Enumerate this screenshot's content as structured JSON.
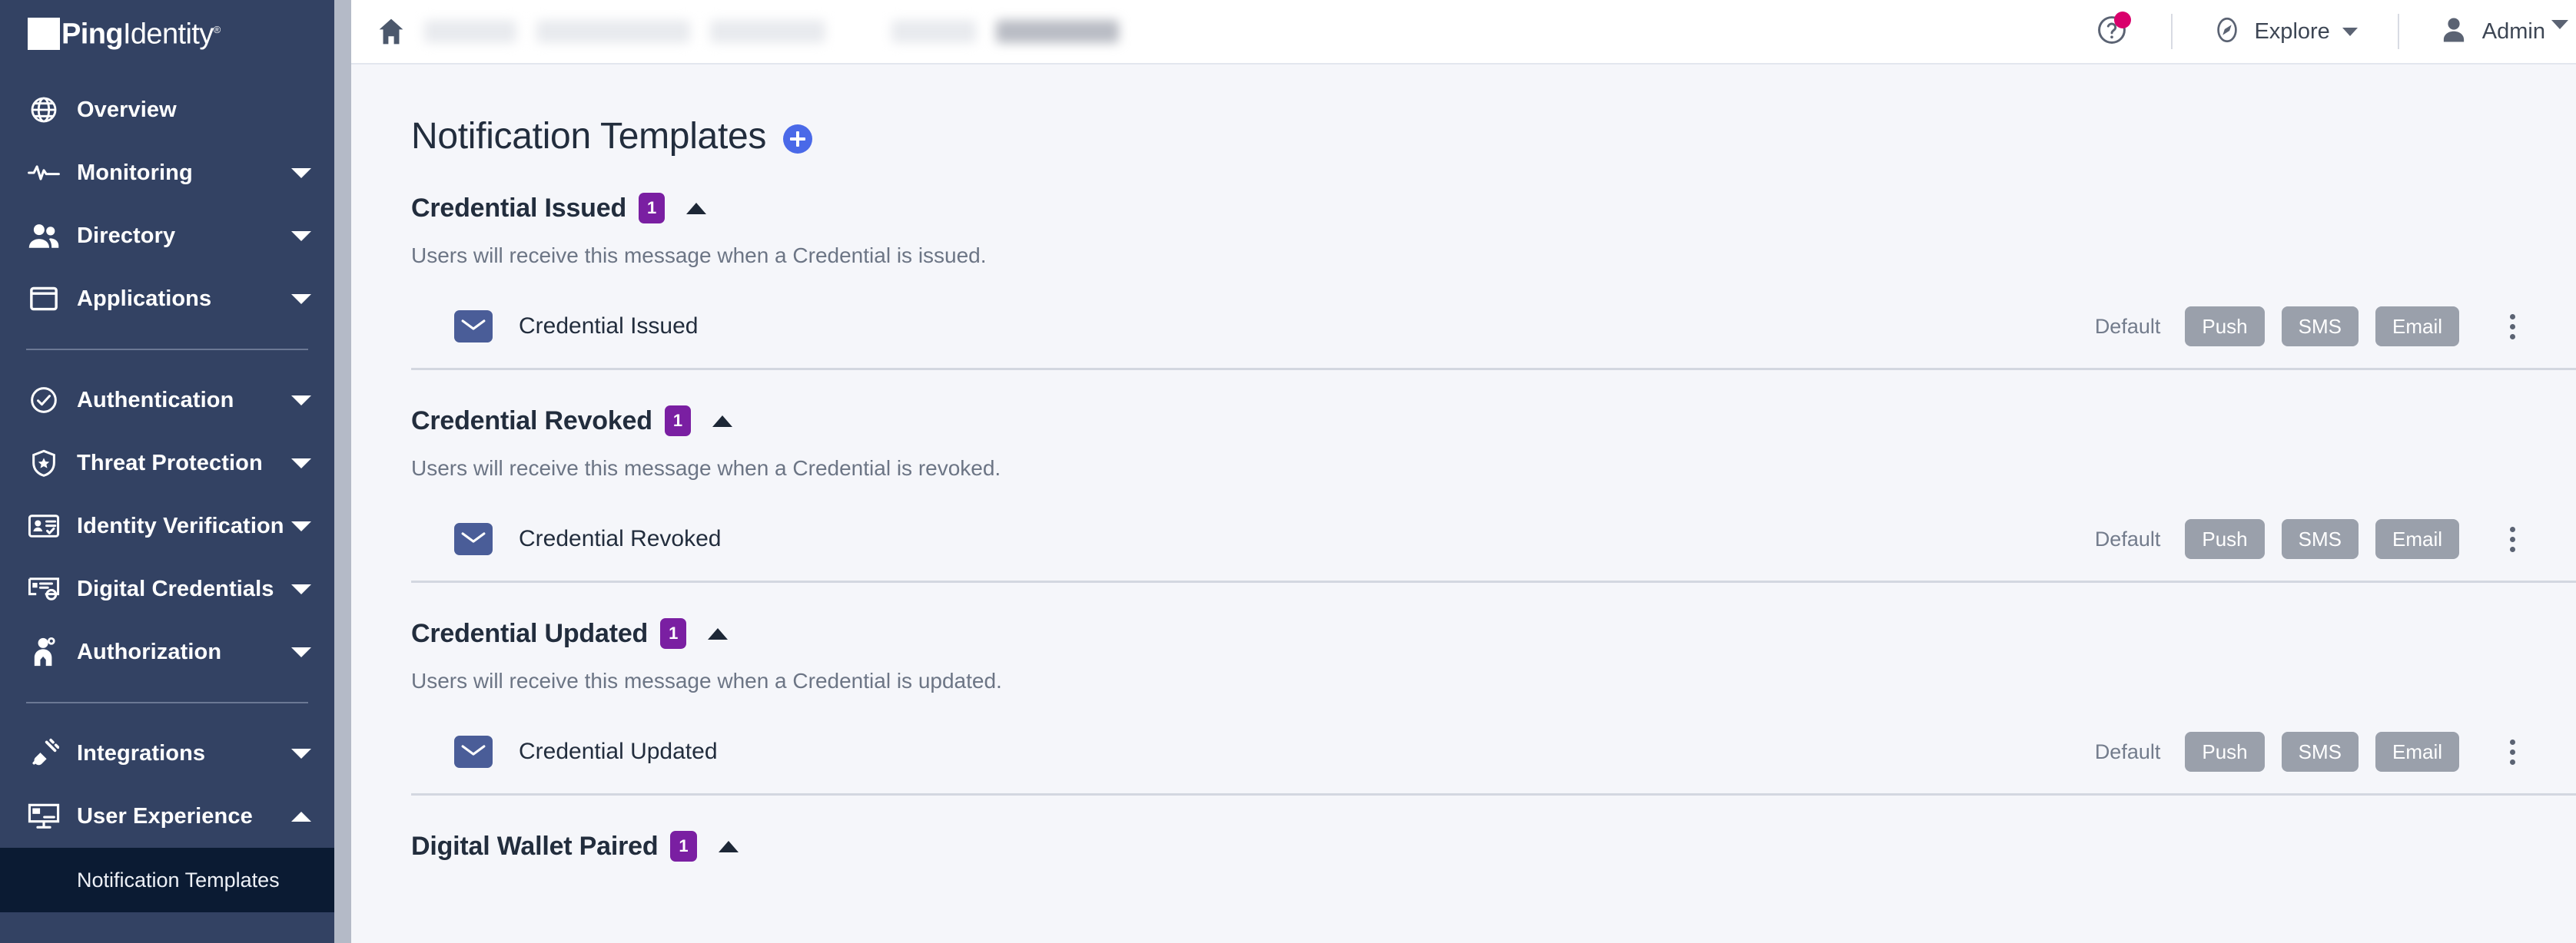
{
  "brand": {
    "name_bold": "Ping",
    "name_light": "Identity",
    "registered": "®"
  },
  "sidebar": {
    "items": [
      {
        "label": "Overview",
        "icon": "globe-icon",
        "expandable": false,
        "expanded": false
      },
      {
        "label": "Monitoring",
        "icon": "pulse-icon",
        "expandable": true,
        "expanded": false
      },
      {
        "label": "Directory",
        "icon": "users-icon",
        "expandable": true,
        "expanded": false
      },
      {
        "label": "Applications",
        "icon": "window-icon",
        "expandable": true,
        "expanded": false
      },
      {
        "label": "Authentication",
        "icon": "check-circle-icon",
        "expandable": true,
        "expanded": false
      },
      {
        "label": "Threat Protection",
        "icon": "shield-star-icon",
        "expandable": true,
        "expanded": false
      },
      {
        "label": "Identity Verification",
        "icon": "id-card-icon",
        "expandable": true,
        "expanded": false
      },
      {
        "label": "Digital Credentials",
        "icon": "certificate-icon",
        "expandable": true,
        "expanded": false
      },
      {
        "label": "Authorization",
        "icon": "key-person-icon",
        "expandable": true,
        "expanded": false
      },
      {
        "label": "Integrations",
        "icon": "plug-icon",
        "expandable": true,
        "expanded": false
      },
      {
        "label": "User Experience",
        "icon": "monitor-icon",
        "expandable": true,
        "expanded": true
      }
    ],
    "sub_item": {
      "label": "Notification Templates",
      "active": true
    },
    "accent_bg": "#334263",
    "active_bg": "#0b1b33"
  },
  "header": {
    "home_icon": "home-icon",
    "breadcrumb_redacted": true,
    "help": {
      "icon": "help-circle-icon",
      "has_notification_dot": true,
      "dot_color": "#d9006c"
    },
    "explore": {
      "label": "Explore",
      "icon": "compass-icon"
    },
    "user": {
      "label": "Admin",
      "icon": "person-icon"
    }
  },
  "main": {
    "title": "Notification Templates",
    "add_button_icon": "plus-icon",
    "add_button_color": "#4a69e8",
    "badge_color": "#7a1fa2",
    "channel_button_color": "#9aa0ab",
    "sections": [
      {
        "title": "Credential Issued",
        "count": "1",
        "expanded": true,
        "description": "Users will receive this message when a Credential is issued.",
        "templates": [
          {
            "name": "Credential Issued",
            "icon": "mail-icon",
            "default_label": "Default",
            "channels": [
              "Push",
              "SMS",
              "Email"
            ],
            "menu_icon": "kebab-menu-icon"
          }
        ]
      },
      {
        "title": "Credential Revoked",
        "count": "1",
        "expanded": true,
        "description": "Users will receive this message when a Credential is revoked.",
        "templates": [
          {
            "name": "Credential Revoked",
            "icon": "mail-icon",
            "default_label": "Default",
            "channels": [
              "Push",
              "SMS",
              "Email"
            ],
            "menu_icon": "kebab-menu-icon"
          }
        ]
      },
      {
        "title": "Credential Updated",
        "count": "1",
        "expanded": true,
        "description": "Users will receive this message when a Credential is updated.",
        "templates": [
          {
            "name": "Credential Updated",
            "icon": "mail-icon",
            "default_label": "Default",
            "channels": [
              "Push",
              "SMS",
              "Email"
            ],
            "menu_icon": "kebab-menu-icon"
          }
        ]
      },
      {
        "title": "Digital Wallet Paired",
        "count": "1",
        "expanded": true,
        "description": "",
        "templates": []
      }
    ]
  }
}
